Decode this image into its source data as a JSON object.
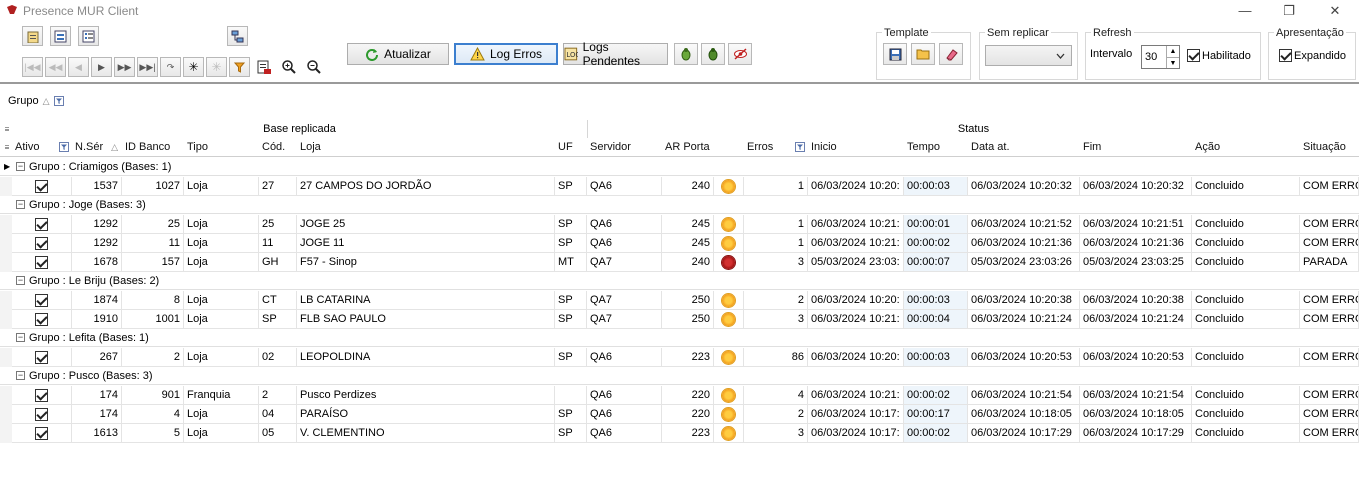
{
  "window": {
    "title": "Presence MUR Client",
    "minimize": "—",
    "maximize": "❐",
    "close": "✕"
  },
  "toolbar": {
    "atualizar_label": "Atualizar",
    "log_erros_label": "Log Erros",
    "logs_pendentes_label": "Logs Pendentes",
    "template_label": "Template",
    "sem_replicar_label": "Sem replicar",
    "sem_replicar_value": "",
    "refresh_label": "Refresh",
    "intervalo_label": "Intervalo",
    "intervalo_value": "30",
    "habilitado_label": "Habilitado",
    "apresentacao_label": "Apresentação",
    "expandido_label": "Expandido"
  },
  "group_panel": {
    "chip_label": "Grupo"
  },
  "grid": {
    "band_base": "Base replicada",
    "band_status": "Status",
    "columns": {
      "ativo": "Ativo",
      "nser": "N.Sér",
      "idbanco": "ID Banco",
      "tipo": "Tipo",
      "cod": "Cód.",
      "loja": "Loja",
      "uf": "UF",
      "servidor": "Servidor",
      "arporta": "AR Porta",
      "erros": "Erros",
      "inicio": "Inicio",
      "tempo": "Tempo",
      "dataat": "Data at.",
      "fim": "Fim",
      "acao": "Ação",
      "situacao": "Situação"
    },
    "groups": [
      {
        "label": "Grupo  : Criamigos (Bases: 1)",
        "rows": [
          {
            "nser": "1537",
            "idbanco": "1027",
            "tipo": "Loja",
            "cod": "27",
            "loja": "27 CAMPOS DO JORDÃO",
            "uf": "SP",
            "servidor": "QA6",
            "arporta": "240",
            "status": "ok",
            "erros": "1",
            "inicio": "06/03/2024 10:20:",
            "tempo": "00:00:03",
            "dataat": "06/03/2024 10:20:32",
            "fim": "06/03/2024 10:20:32",
            "acao": "Concluido",
            "situacao": "COM ERRO"
          }
        ]
      },
      {
        "label": "Grupo  : Joge (Bases: 3)",
        "rows": [
          {
            "nser": "1292",
            "idbanco": "25",
            "tipo": "Loja",
            "cod": "25",
            "loja": "JOGE 25",
            "uf": "SP",
            "servidor": "QA6",
            "arporta": "245",
            "status": "ok",
            "erros": "1",
            "inicio": "06/03/2024 10:21:",
            "tempo": "00:00:01",
            "dataat": "06/03/2024 10:21:52",
            "fim": "06/03/2024 10:21:51",
            "acao": "Concluido",
            "situacao": "COM ERRO"
          },
          {
            "nser": "1292",
            "idbanco": "11",
            "tipo": "Loja",
            "cod": "11",
            "loja": "JOGE 11",
            "uf": "SP",
            "servidor": "QA6",
            "arporta": "245",
            "status": "ok",
            "erros": "1",
            "inicio": "06/03/2024 10:21:",
            "tempo": "00:00:02",
            "dataat": "06/03/2024 10:21:36",
            "fim": "06/03/2024 10:21:36",
            "acao": "Concluido",
            "situacao": "COM ERRO"
          },
          {
            "nser": "1678",
            "idbanco": "157",
            "tipo": "Loja",
            "cod": "GH",
            "loja": "F57 - Sinop",
            "uf": "MT",
            "servidor": "QA7",
            "arporta": "240",
            "status": "stopped",
            "erros": "3",
            "inicio": "05/03/2024 23:03:",
            "tempo": "00:00:07",
            "dataat": "05/03/2024 23:03:26",
            "fim": "05/03/2024 23:03:25",
            "acao": "Concluido",
            "situacao": "PARADA"
          }
        ]
      },
      {
        "label": "Grupo  : Le Briju (Bases: 2)",
        "rows": [
          {
            "nser": "1874",
            "idbanco": "8",
            "tipo": "Loja",
            "cod": "CT",
            "loja": "LB CATARINA",
            "uf": "SP",
            "servidor": "QA7",
            "arporta": "250",
            "status": "ok",
            "erros": "2",
            "inicio": "06/03/2024 10:20:",
            "tempo": "00:00:03",
            "dataat": "06/03/2024 10:20:38",
            "fim": "06/03/2024 10:20:38",
            "acao": "Concluido",
            "situacao": "COM ERRO"
          },
          {
            "nser": "1910",
            "idbanco": "1001",
            "tipo": "Loja",
            "cod": "SP",
            "loja": "FLB SAO PAULO",
            "uf": "SP",
            "servidor": "QA7",
            "arporta": "250",
            "status": "ok",
            "erros": "3",
            "inicio": "06/03/2024 10:21:",
            "tempo": "00:00:04",
            "dataat": "06/03/2024 10:21:24",
            "fim": "06/03/2024 10:21:24",
            "acao": "Concluido",
            "situacao": "COM ERRO"
          }
        ]
      },
      {
        "label": "Grupo  : Lefita (Bases: 1)",
        "rows": [
          {
            "nser": "267",
            "idbanco": "2",
            "tipo": "Loja",
            "cod": "02",
            "loja": "LEOPOLDINA",
            "uf": "SP",
            "servidor": "QA6",
            "arporta": "223",
            "status": "ok",
            "erros": "86",
            "inicio": "06/03/2024 10:20:",
            "tempo": "00:00:03",
            "dataat": "06/03/2024 10:20:53",
            "fim": "06/03/2024 10:20:53",
            "acao": "Concluido",
            "situacao": "COM ERRO"
          }
        ]
      },
      {
        "label": "Grupo  : Pusco (Bases: 3)",
        "rows": [
          {
            "nser": "174",
            "idbanco": "901",
            "tipo": "Franquia",
            "cod": "2",
            "loja": "Pusco Perdizes",
            "uf": "",
            "servidor": "QA6",
            "arporta": "220",
            "status": "ok",
            "erros": "4",
            "inicio": "06/03/2024 10:21:",
            "tempo": "00:00:02",
            "dataat": "06/03/2024 10:21:54",
            "fim": "06/03/2024 10:21:54",
            "acao": "Concluido",
            "situacao": "COM ERRO"
          },
          {
            "nser": "174",
            "idbanco": "4",
            "tipo": "Loja",
            "cod": "04",
            "loja": "PARAÍSO",
            "uf": "SP",
            "servidor": "QA6",
            "arporta": "220",
            "status": "ok",
            "erros": "2",
            "inicio": "06/03/2024 10:17:",
            "tempo": "00:00:17",
            "dataat": "06/03/2024 10:18:05",
            "fim": "06/03/2024 10:18:05",
            "acao": "Concluido",
            "situacao": "COM ERRO"
          },
          {
            "nser": "1613",
            "idbanco": "5",
            "tipo": "Loja",
            "cod": "05",
            "loja": "V. CLEMENTINO",
            "uf": "SP",
            "servidor": "QA6",
            "arporta": "223",
            "status": "ok",
            "erros": "3",
            "inicio": "06/03/2024 10:17:",
            "tempo": "00:00:02",
            "dataat": "06/03/2024 10:17:29",
            "fim": "06/03/2024 10:17:29",
            "acao": "Concluido",
            "situacao": "COM ERRO"
          }
        ]
      }
    ]
  },
  "colors": {
    "accent": "#3c7fcf",
    "status_ok": "#f2a91e",
    "status_stopped": "#b01818",
    "tempo_bg": "#eef5fb"
  }
}
